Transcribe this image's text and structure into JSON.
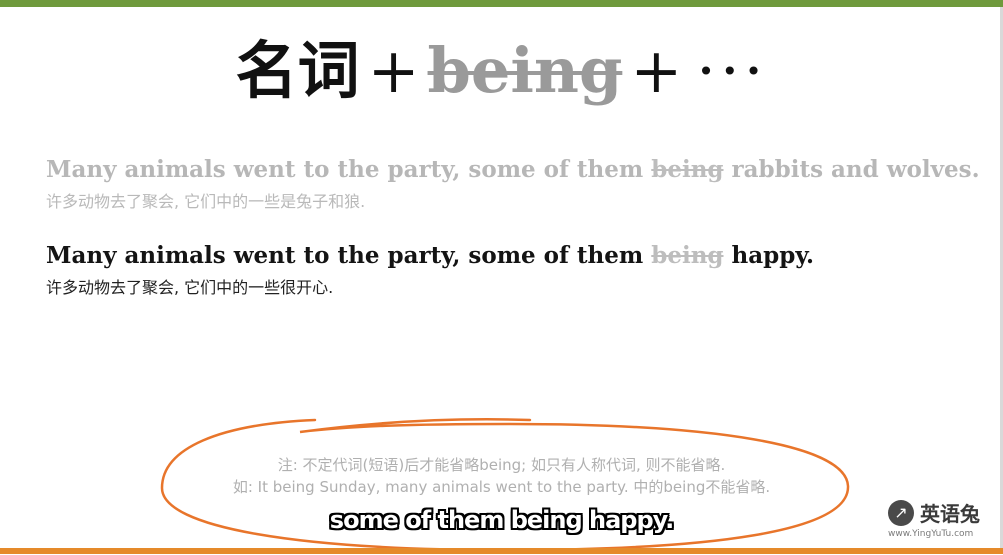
{
  "title": {
    "noun": "名词",
    "plus1": "+",
    "being": "being",
    "plus2": "+",
    "ellipsis": "···"
  },
  "example1": {
    "en_before": "Many animals went to the party, some of them",
    "en_strike": "being",
    "en_after": "rabbits and wolves.",
    "zh": "许多动物去了聚会, 它们中的一些是兔子和狼."
  },
  "example2": {
    "en_before": "Many animals went to the party, some of them",
    "en_strike": "being",
    "en_after": "happy.",
    "zh": "许多动物去了聚会, 它们中的一些很开心."
  },
  "note": {
    "line1": "注: 不定代词(短语)后才能省略being; 如只有人称代词, 则不能省略.",
    "line2": "如: It being Sunday, many animals went to the party. 中的being不能省略."
  },
  "subtitle": "some of them being happy.",
  "logo": {
    "name": "英语兔",
    "url": "www.YingYuTu.com"
  },
  "colors": {
    "top_bar": "#6f9a3c",
    "bottom_bar": "#e58a2a",
    "annotation_ring": "#e8752b"
  }
}
